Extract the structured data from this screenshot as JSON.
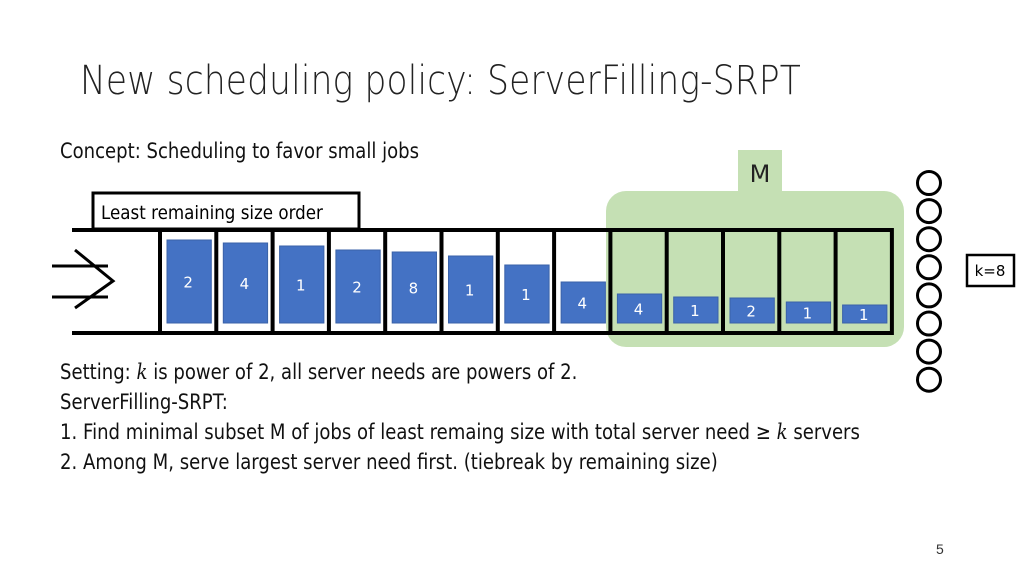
{
  "title": "New scheduling policy: ServerFilling-SRPT",
  "concept": "Concept: Scheduling to favor small jobs",
  "diagram": {
    "order_label": "Least remaining size order",
    "subset_label": "M",
    "k_label": "k=8",
    "server_count": 8,
    "jobs": [
      "2",
      "4",
      "1",
      "2",
      "8",
      "1",
      "1",
      "4",
      "4",
      "1",
      "2",
      "1",
      "1"
    ],
    "subset_start_index": 8,
    "colors": {
      "job": "#4472c4",
      "subset": "#c5e0b4",
      "outline": "#000000"
    }
  },
  "setting": {
    "prefix": "Setting: ",
    "var": "k",
    "suffix": " is power of 2, all server needs are powers of 2."
  },
  "policy_name": "ServerFilling-SRPT:",
  "steps": [
    {
      "num": "1.",
      "text": "Find minimal subset M of jobs of least remaing size with total server need ",
      "symbol": "≥",
      "var": "k",
      "tail": " servers"
    },
    {
      "num": "2.",
      "text": "Among M, serve largest server need first. (tiebreak by remaining size)"
    }
  ],
  "page_number": "5"
}
